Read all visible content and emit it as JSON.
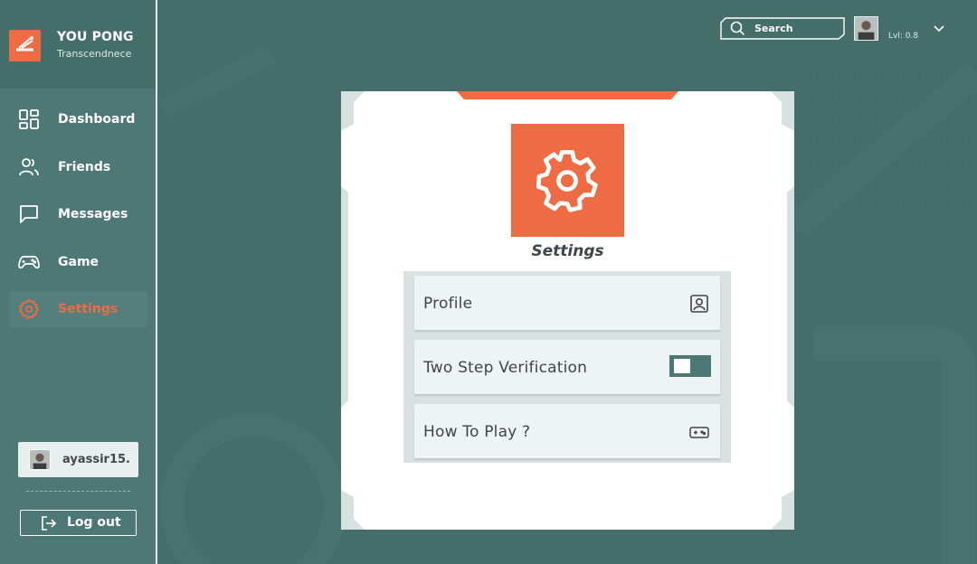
{
  "brand": {
    "title": "YOU PONG",
    "subtitle": "Transcendnece"
  },
  "sidebar": {
    "items": [
      {
        "label": "Dashboard",
        "icon": "dashboard-icon",
        "active": false
      },
      {
        "label": "Friends",
        "icon": "friends-icon",
        "active": false
      },
      {
        "label": "Messages",
        "icon": "messages-icon",
        "active": false
      },
      {
        "label": "Game",
        "icon": "gamepad-icon",
        "active": false
      },
      {
        "label": "Settings",
        "icon": "gear-icon",
        "active": true
      }
    ],
    "user": {
      "username": "ayassir15."
    },
    "logout_label": "Log out"
  },
  "header": {
    "search_placeholder": "Search",
    "level": "Lvl: 0.8"
  },
  "settings": {
    "title": "Settings",
    "options": [
      {
        "label": "Profile",
        "icon": "profile-icon"
      },
      {
        "label": "Two Step Verification",
        "control": "toggle",
        "enabled": false
      },
      {
        "label": "How To Play ?",
        "icon": "controller-icon"
      }
    ]
  },
  "colors": {
    "accent": "#ef6b43",
    "background": "#456e6a",
    "sidebar": "#4d7875",
    "card": "#ffffff",
    "option_bg": "#eef3f3",
    "text_dark": "#3d4747"
  }
}
